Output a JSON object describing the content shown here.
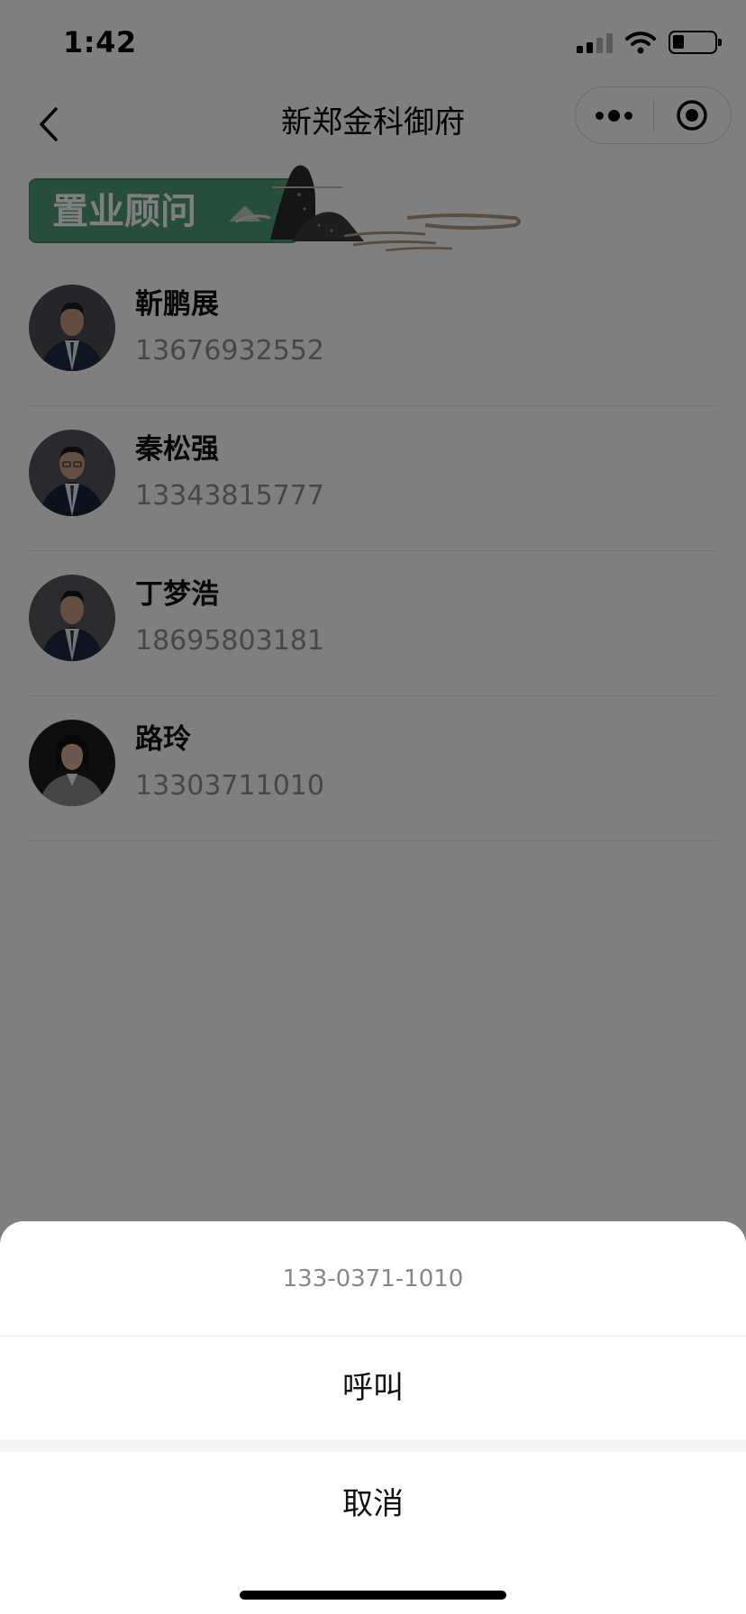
{
  "status_bar": {
    "time": "1:42",
    "icons": [
      "cellular-signal-icon",
      "wifi-icon",
      "battery-icon"
    ],
    "battery_level": 0.2
  },
  "nav": {
    "title": "新郑金科御府",
    "back_icon": "chevron-left-icon",
    "menu_icon": "more-dots-icon",
    "close_icon": "target-circle-icon"
  },
  "banner": {
    "label": "置业顾问",
    "colors": {
      "green": "#4f9a78",
      "mountain": "#2b2b2b",
      "cloud": "#b29b83"
    }
  },
  "advisors": [
    {
      "name": "靳鹏展",
      "phone": "13676932552"
    },
    {
      "name": "秦松强",
      "phone": "13343815777"
    },
    {
      "name": "丁梦浩",
      "phone": "18695803181"
    },
    {
      "name": "路玲",
      "phone": "13303711010"
    }
  ],
  "action_sheet": {
    "title": "133-0371-1010",
    "call_label": "呼叫",
    "cancel_label": "取消"
  },
  "colors": {
    "overlay": "rgba(0,0,0,0.5)",
    "phone_text": "#8e8e8e",
    "divider": "#e6e6e6"
  }
}
